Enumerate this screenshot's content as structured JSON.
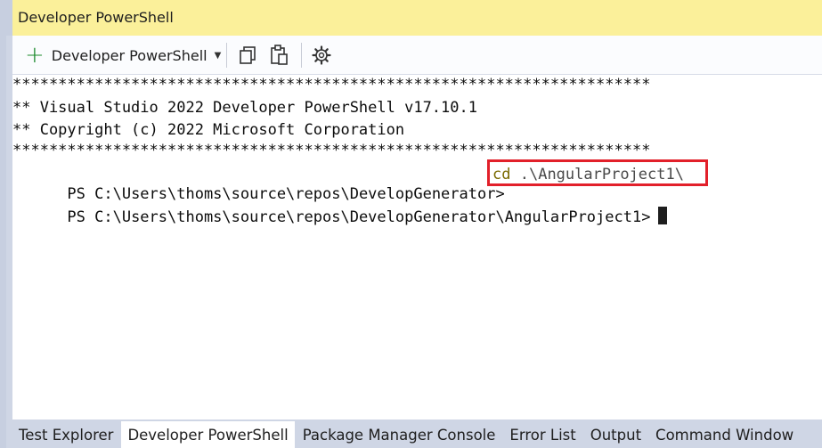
{
  "window": {
    "title": "Developer PowerShell"
  },
  "toolbar": {
    "new_terminal_label": "Developer PowerShell",
    "new_terminal_icon": "plus-icon",
    "dropdown_icon": "caret-down-icon",
    "copy_icon": "copy-icon",
    "paste_icon": "paste-icon",
    "settings_icon": "gear-icon"
  },
  "terminal": {
    "lines": [
      "**********************************************************************",
      "** Visual Studio 2022 Developer PowerShell v17.10.1",
      "** Copyright (c) 2022 Microsoft Corporation",
      "**********************************************************************"
    ],
    "prompt1": "PS C:\\Users\\thoms\\source\\repos\\DevelopGenerator>",
    "command_keyword": "cd",
    "command_arg": ".\\AngularProject1\\",
    "prompt2": "PS C:\\Users\\thoms\\source\\repos\\DevelopGenerator\\AngularProject1>"
  },
  "tabs": [
    {
      "label": "Test Explorer"
    },
    {
      "label": "Developer PowerShell"
    },
    {
      "label": "Package Manager Console"
    },
    {
      "label": "Error List"
    },
    {
      "label": "Output"
    },
    {
      "label": "Command Window"
    }
  ],
  "colors": {
    "highlight_box": "#e2202a",
    "titlebar": "#fbf09a",
    "chrome": "#cfd6e5"
  }
}
